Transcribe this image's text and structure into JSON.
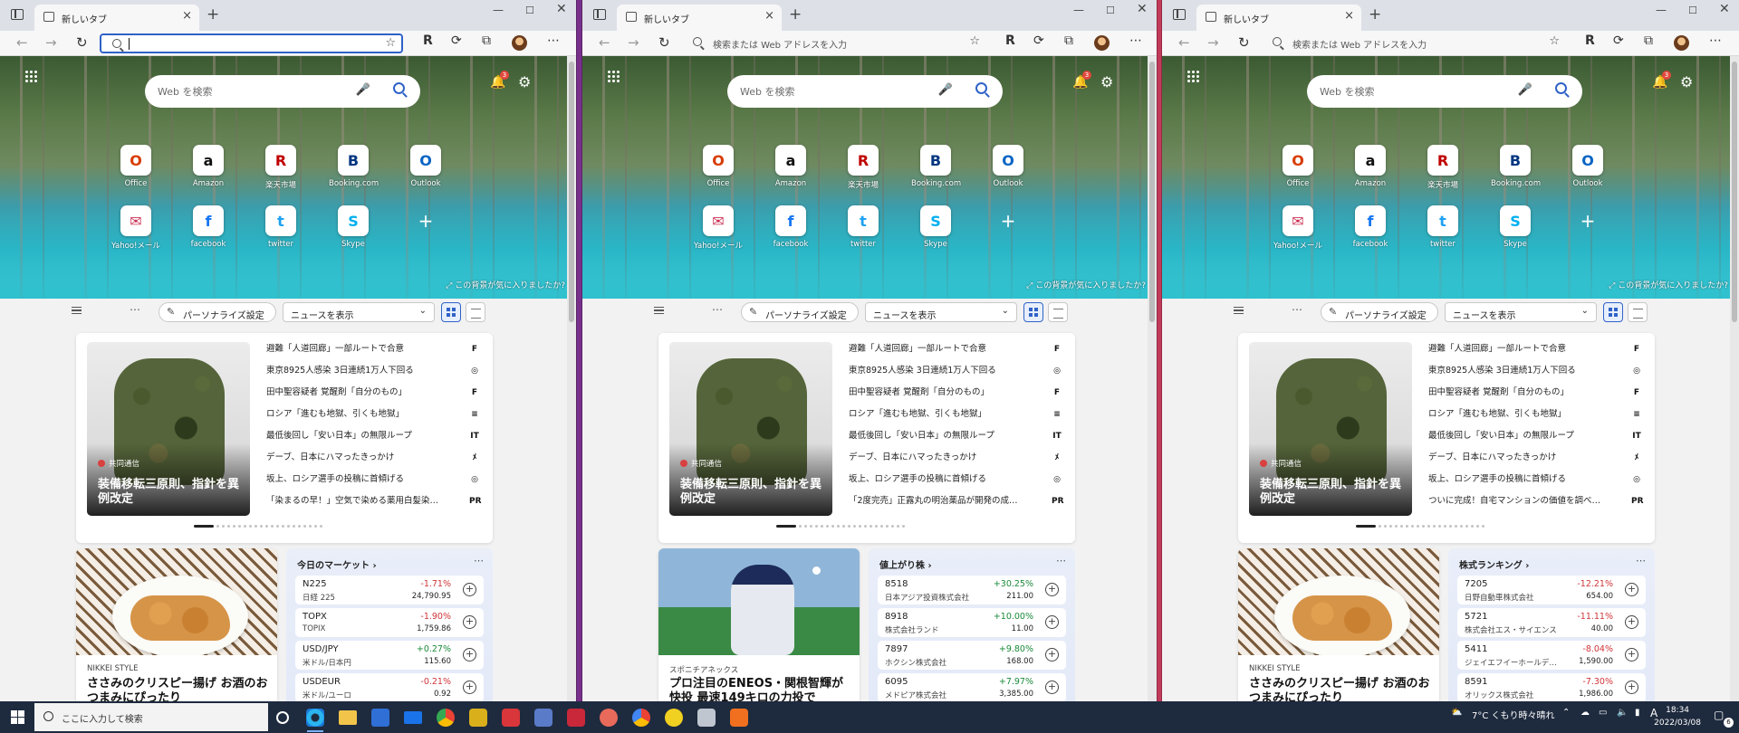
{
  "browser": {
    "tab_title": "新しいタブ",
    "address_placeholder": "検索または Web アドレスを入力"
  },
  "newtab": {
    "search_placeholder": "Web を検索",
    "notification_count": "3",
    "like_background": "この背景が気に入りましたか?",
    "tiles": [
      {
        "label": "Office",
        "icon": "office-icon",
        "glyph": "O",
        "color": "#d83b01"
      },
      {
        "label": "Amazon",
        "icon": "amazon-icon",
        "glyph": "a",
        "color": "#111111"
      },
      {
        "label": "楽天市場",
        "icon": "rakuten-icon",
        "glyph": "R",
        "color": "#bf0000"
      },
      {
        "label": "Booking.com",
        "icon": "booking-icon",
        "glyph": "B",
        "color": "#003580"
      },
      {
        "label": "Outlook",
        "icon": "outlook-icon",
        "glyph": "O",
        "color": "#0a64c4"
      },
      {
        "label": "Yahoo!メール",
        "icon": "yahoo-mail-icon",
        "glyph": "✉",
        "color": "#cc3355"
      },
      {
        "label": "facebook",
        "icon": "facebook-icon",
        "glyph": "f",
        "color": "#1877f2"
      },
      {
        "label": "twitter",
        "icon": "twitter-icon",
        "glyph": "t",
        "color": "#1da1f2"
      },
      {
        "label": "Skype",
        "icon": "skype-icon",
        "glyph": "S",
        "color": "#00aff0"
      }
    ]
  },
  "feed_bar": {
    "personalize_label": "パーソナライズ設定",
    "news_dropdown": "ニュースを表示"
  },
  "windows": [
    {
      "address_focused": true,
      "top_story": {
        "source": "共同通信",
        "headline": "装備移転三原則、指針を異例改定"
      },
      "headlines": [
        {
          "text": "避難「人道回廊」一部ルートで合意",
          "source_icon": "F"
        },
        {
          "text": "東京8925人感染 3日連続1万人下回る",
          "source_icon": "◎"
        },
        {
          "text": "田中聖容疑者 覚醒剤「自分のもの」",
          "source_icon": "F"
        },
        {
          "text": "ロシア「進むも地獄、引くも地獄」",
          "source_icon": "≡"
        },
        {
          "text": "最低後回し「安い日本」の無限ループ",
          "source_icon": "IT"
        },
        {
          "text": "デーブ、日本にハマったきっかけ",
          "source_icon": "ﾒ"
        },
        {
          "text": "坂上、ロシア選手の投稿に首傾げる",
          "source_icon": "◎"
        },
        {
          "text": "「染まるの早！」空気で染める薬用白髪染…",
          "source_icon": "PR"
        }
      ],
      "story": {
        "type": "food",
        "source": "NIKKEI STYLE",
        "headline": "ささみのクリスピー揚げ お酒のおつまみにぴったり"
      },
      "panel": {
        "title": "今日のマーケット",
        "rows": [
          {
            "symbol": "N225",
            "name": "日経 225",
            "change": "-1.71%",
            "price": "24,790.95",
            "dir": "down"
          },
          {
            "symbol": "TOPX",
            "name": "TOPIX",
            "change": "-1.90%",
            "price": "1,759.86",
            "dir": "down"
          },
          {
            "symbol": "USD/JPY",
            "name": "米ドル/日本円",
            "change": "+0.27%",
            "price": "115.60",
            "dir": "up"
          },
          {
            "symbol": "USDEUR",
            "name": "米ドル/ユーロ",
            "change": "-0.21%",
            "price": "0.92",
            "dir": "down"
          }
        ]
      }
    },
    {
      "address_focused": false,
      "top_story": {
        "source": "共同通信",
        "headline": "装備移転三原則、指針を異例改定"
      },
      "headlines": [
        {
          "text": "避難「人道回廊」一部ルートで合意",
          "source_icon": "F"
        },
        {
          "text": "東京8925人感染 3日連続1万人下回る",
          "source_icon": "◎"
        },
        {
          "text": "田中聖容疑者 覚醒剤「自分のもの」",
          "source_icon": "F"
        },
        {
          "text": "ロシア「進むも地獄、引くも地獄」",
          "source_icon": "≡"
        },
        {
          "text": "最低後回し「安い日本」の無限ループ",
          "source_icon": "IT"
        },
        {
          "text": "デーブ、日本にハマったきっかけ",
          "source_icon": "ﾒ"
        },
        {
          "text": "坂上、ロシア選手の投稿に首傾げる",
          "source_icon": "◎"
        },
        {
          "text": "「2度完売」正露丸の明治薬品が開発の成…",
          "source_icon": "PR"
        }
      ],
      "story": {
        "type": "baseball",
        "source": "スポニチアネックス",
        "headline": "プロ注目のENEOS・関根智輝が快投 最速149キロの力投で"
      },
      "panel": {
        "title": "値上がり株",
        "rows": [
          {
            "symbol": "8518",
            "name": "日本アジア投資株式会社",
            "change": "+30.25%",
            "price": "211.00",
            "dir": "up"
          },
          {
            "symbol": "8918",
            "name": "株式会社ランド",
            "change": "+10.00%",
            "price": "11.00",
            "dir": "up"
          },
          {
            "symbol": "7897",
            "name": "ホクシン株式会社",
            "change": "+9.80%",
            "price": "168.00",
            "dir": "up"
          },
          {
            "symbol": "6095",
            "name": "メドピア株式会社",
            "change": "+7.97%",
            "price": "3,385.00",
            "dir": "up"
          }
        ]
      }
    },
    {
      "address_focused": false,
      "top_story": {
        "source": "共同通信",
        "headline": "装備移転三原則、指針を異例改定"
      },
      "headlines": [
        {
          "text": "避難「人道回廊」一部ルートで合意",
          "source_icon": "F"
        },
        {
          "text": "東京8925人感染 3日連続1万人下回る",
          "source_icon": "◎"
        },
        {
          "text": "田中聖容疑者 覚醒剤「自分のもの」",
          "source_icon": "F"
        },
        {
          "text": "ロシア「進むも地獄、引くも地獄」",
          "source_icon": "≡"
        },
        {
          "text": "最低後回し「安い日本」の無限ループ",
          "source_icon": "IT"
        },
        {
          "text": "デーブ、日本にハマったきっかけ",
          "source_icon": "ﾒ"
        },
        {
          "text": "坂上、ロシア選手の投稿に首傾げる",
          "source_icon": "◎"
        },
        {
          "text": "ついに完成！自宅マンションの価値を調べ…",
          "source_icon": "PR"
        }
      ],
      "story": {
        "type": "food",
        "source": "NIKKEI STYLE",
        "headline": "ささみのクリスピー揚げ お酒のおつまみにぴったり"
      },
      "panel": {
        "title": "株式ランキング",
        "rows": [
          {
            "symbol": "7205",
            "name": "日野自動車株式会社",
            "change": "-12.21%",
            "price": "654.00",
            "dir": "down"
          },
          {
            "symbol": "5721",
            "name": "株式会社エス・サイエンス",
            "change": "-11.11%",
            "price": "40.00",
            "dir": "down"
          },
          {
            "symbol": "5411",
            "name": "ジェイエフイーホールデ…",
            "change": "-8.04%",
            "price": "1,590.00",
            "dir": "down"
          },
          {
            "symbol": "8591",
            "name": "オリックス株式会社",
            "change": "-7.30%",
            "price": "1,986.00",
            "dir": "down"
          }
        ]
      }
    }
  ],
  "colors": {
    "up": "#1a8a3a",
    "down": "#d13438",
    "accent": "#2f62c8"
  },
  "taskbar": {
    "search_placeholder": "ここに入力して検索",
    "weather": "7°C くもり時々晴れ",
    "ime": "A",
    "time": "18:34",
    "date": "2022/03/08",
    "notification_count": "6"
  }
}
